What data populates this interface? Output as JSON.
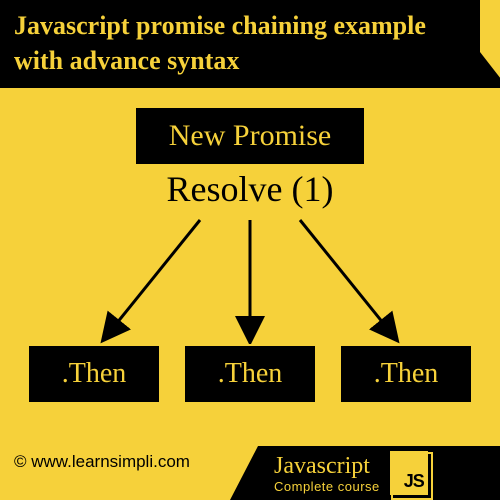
{
  "title": "Javascript promise chaining example with advance syntax",
  "diagram": {
    "top_node": "New Promise",
    "resolve_label": "Resolve (1)",
    "then_nodes": [
      ".Then",
      ".Then",
      ".Then"
    ]
  },
  "credit": "© www.learnsimpli.com",
  "brand": {
    "main": "Javascript",
    "sub": "Complete course",
    "badge": "JS"
  },
  "colors": {
    "bg": "#f6d13a",
    "fg": "#000000"
  }
}
